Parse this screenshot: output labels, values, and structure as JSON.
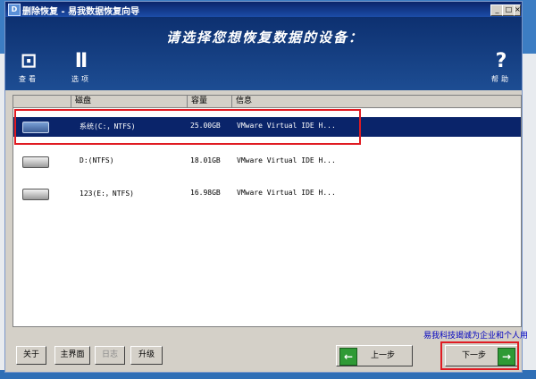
{
  "window": {
    "title": "删除恢复 - 易我数据恢复向导",
    "app_icon": "D",
    "minimize": "_",
    "maximize": "□",
    "close": "×"
  },
  "banner": {
    "prompt": "请选择您想恢复数据的设备：",
    "tools": [
      {
        "label": "查看",
        "icon": "view-icon"
      },
      {
        "label": "选项",
        "icon": "options-icon"
      },
      {
        "label": "帮助",
        "icon": "help-icon"
      }
    ]
  },
  "list": {
    "columns": [
      "磁盘",
      "容量",
      "信息"
    ],
    "rows": [
      {
        "disk": "系统(C:，NTFS)",
        "capacity": "25.00GB",
        "info": "VMware Virtual IDE H...",
        "selected": true
      },
      {
        "disk": "D:(NTFS)",
        "capacity": "18.01GB",
        "info": "VMware Virtual IDE H...",
        "selected": false
      },
      {
        "disk": "123(E:，NTFS)",
        "capacity": "16.98GB",
        "info": "VMware Virtual IDE H...",
        "selected": false
      }
    ]
  },
  "footer": {
    "brand": "易我科技竭诚为企业和个人用",
    "buttons": {
      "about": "关于",
      "main": "主界面",
      "log": "日志",
      "upgrade": "升级"
    },
    "prev": "上一步",
    "next": "下一步"
  },
  "colors": {
    "banner": "#0d3070",
    "selection": "#0a246a",
    "highlight": "#e01b22",
    "nav_arrow": "#2f9a35"
  }
}
